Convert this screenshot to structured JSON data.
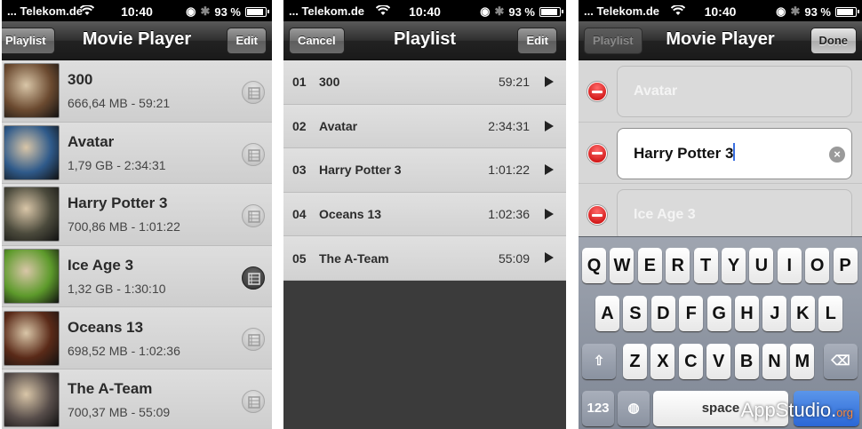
{
  "screen1": {
    "status": {
      "carrier": "... Telekom.de",
      "time": "10:40",
      "battery": "93 %"
    },
    "nav": {
      "left": "Playlist",
      "title": "Movie Player",
      "right": "Edit"
    },
    "movies": [
      {
        "title": "300",
        "meta": "666,64 MB - 59:21",
        "color": "#6b4a30",
        "active": false
      },
      {
        "title": "Avatar",
        "meta": "1,79 GB - 2:34:31",
        "color": "#2f5a8a",
        "active": false
      },
      {
        "title": "Harry Potter 3",
        "meta": "700,86 MB - 1:01:22",
        "color": "#4b4a3c",
        "active": false
      },
      {
        "title": "Ice Age 3",
        "meta": "1,32 GB - 1:30:10",
        "color": "#5d9a2b",
        "active": true
      },
      {
        "title": "Oceans 13",
        "meta": "698,52 MB - 1:02:36",
        "color": "#5a2a18",
        "active": false
      },
      {
        "title": "The  A-Team",
        "meta": "700,37 MB - 55:09",
        "color": "#574d4a",
        "active": false
      }
    ]
  },
  "screen2": {
    "status": {
      "carrier": "... Telekom.de",
      "time": "10:40",
      "battery": "93 %"
    },
    "nav": {
      "left": "Cancel",
      "title": "Playlist",
      "right": "Edit"
    },
    "items": [
      {
        "num": "01",
        "title": "300",
        "duration": "59:21"
      },
      {
        "num": "02",
        "title": "Avatar",
        "duration": "2:34:31"
      },
      {
        "num": "03",
        "title": "Harry Potter 3",
        "duration": "1:01:22"
      },
      {
        "num": "04",
        "title": "Oceans 13",
        "duration": "1:02:36"
      },
      {
        "num": "05",
        "title": "The  A-Team",
        "duration": "55:09"
      }
    ]
  },
  "screen3": {
    "status": {
      "carrier": "... Telekom.de",
      "time": "10:40",
      "battery": "93 %"
    },
    "nav": {
      "left": "Playlist",
      "title": "Movie Player",
      "right": "Done"
    },
    "fields": [
      {
        "value": "Avatar",
        "active": false
      },
      {
        "value": "Harry Potter 3",
        "active": true
      },
      {
        "value": "Ice Age 3",
        "active": false
      }
    ],
    "keyboard": {
      "row1": [
        "Q",
        "W",
        "E",
        "R",
        "T",
        "Y",
        "U",
        "I",
        "O",
        "P"
      ],
      "row2": [
        "A",
        "S",
        "D",
        "F",
        "G",
        "H",
        "J",
        "K",
        "L"
      ],
      "row3": [
        "Z",
        "X",
        "C",
        "V",
        "B",
        "N",
        "M"
      ],
      "numbers": "123",
      "space": "space"
    },
    "watermark": {
      "text": "AppStudio.",
      "suffix": "org"
    }
  }
}
